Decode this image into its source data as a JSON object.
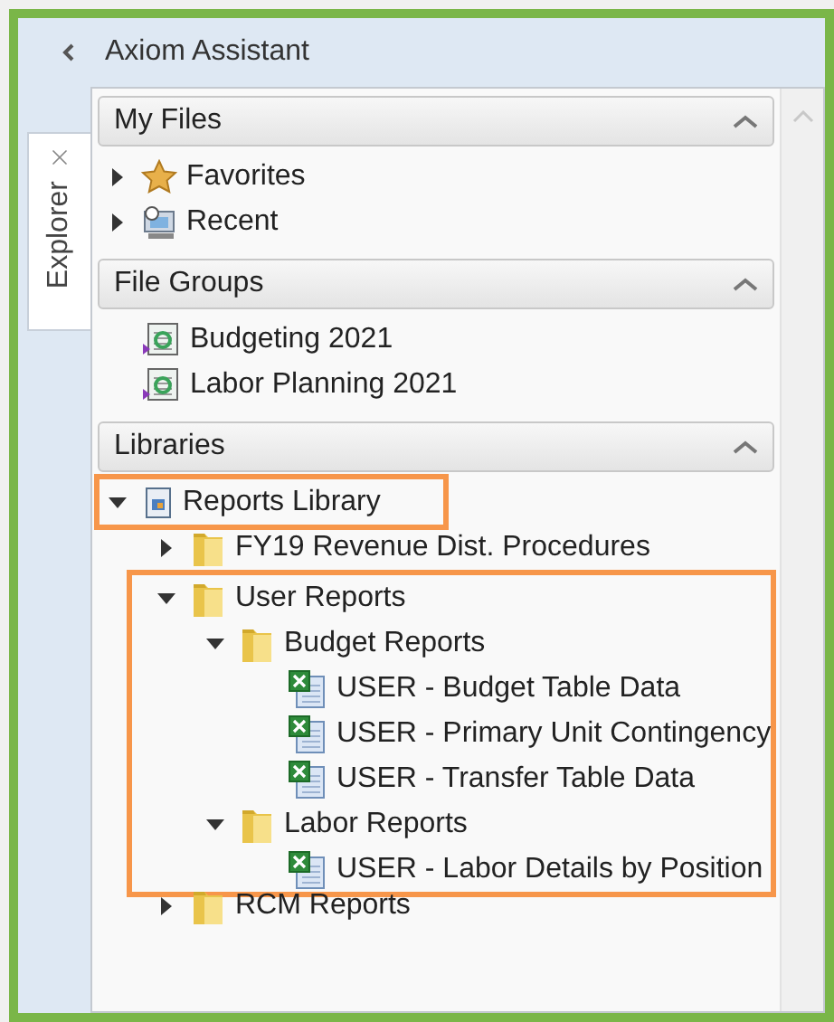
{
  "header": {
    "title": "Axiom Assistant"
  },
  "side_tab": {
    "label": "Explorer"
  },
  "sections": [
    {
      "title": "My Files",
      "expanded": true,
      "items": [
        {
          "label": "Favorites",
          "kind": "star",
          "expanded": false
        },
        {
          "label": "Recent",
          "kind": "recent",
          "expanded": false
        }
      ]
    },
    {
      "title": "File Groups",
      "expanded": true,
      "items": [
        {
          "label": "Budgeting 2021",
          "kind": "file-group"
        },
        {
          "label": "Labor Planning 2021",
          "kind": "file-group"
        }
      ]
    },
    {
      "title": "Libraries",
      "expanded": true,
      "items": [
        {
          "label": "Reports Library",
          "kind": "library",
          "expanded": true,
          "highlighted": true,
          "group_highlighted": false,
          "children": [
            {
              "label": "FY19 Revenue Dist. Procedures",
              "kind": "folder",
              "expanded": false,
              "highlighted": false,
              "group_highlighted": false
            },
            {
              "label": "User Reports",
              "kind": "folder",
              "expanded": true,
              "highlighted": false,
              "group_highlighted": true,
              "children": [
                {
                  "label": "Budget Reports",
                  "kind": "folder",
                  "expanded": true,
                  "children": [
                    {
                      "label": "USER - Budget Table Data",
                      "kind": "excel"
                    },
                    {
                      "label": "USER - Primary Unit Contingency",
                      "kind": "excel"
                    },
                    {
                      "label": "USER - Transfer Table Data",
                      "kind": "excel"
                    }
                  ]
                },
                {
                  "label": "Labor Reports",
                  "kind": "folder",
                  "expanded": true,
                  "children": [
                    {
                      "label": "USER - Labor Details by Position",
                      "kind": "excel"
                    }
                  ]
                }
              ]
            },
            {
              "label": "RCM Reports",
              "kind": "folder",
              "expanded": false,
              "highlighted": false,
              "group_highlighted": false
            }
          ]
        }
      ]
    }
  ]
}
